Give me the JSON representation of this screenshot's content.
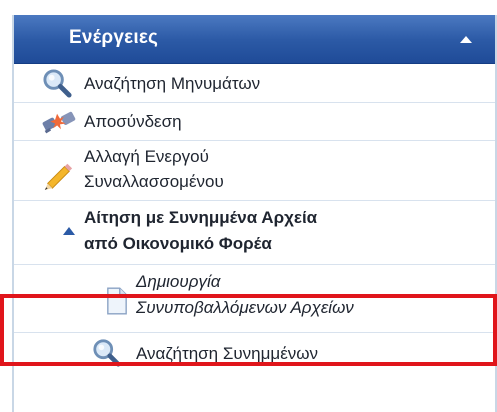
{
  "panel": {
    "title": "Ενέργειες",
    "collapse_icon": "chevron-up-icon"
  },
  "actions": [
    {
      "id": "search-messages",
      "label": "Αναζήτηση Μηνυμάτων",
      "icon": "magnifier-icon"
    },
    {
      "id": "disconnect",
      "label": "Αποσύνδεση",
      "icon": "disconnect-icon"
    },
    {
      "id": "change-counterparty",
      "label_line1": "Αλλαγή Ενεργού",
      "label_line2": "Συναλλασσομένου",
      "icon": "pencil-icon"
    },
    {
      "id": "request-attachments",
      "label_line1": "Αίτηση με Συνημμένα Αρχεία",
      "label_line2": "από Οικονομικό Φορέα",
      "icon": "triangle-up-icon",
      "expanded": true
    },
    {
      "id": "create-cosubmitted-files",
      "label_line1": "Δημιουργία",
      "label_line2": "Συνυποβαλλόμενων Αρχείων",
      "icon": "document-icon",
      "highlighted": true
    },
    {
      "id": "search-attachments",
      "label": "Αναζήτηση Συνημμένων",
      "icon": "magnifier-icon"
    }
  ],
  "colors": {
    "header": "#2c5aa6",
    "highlight": "#e0151b",
    "border": "#c9d7e6"
  }
}
